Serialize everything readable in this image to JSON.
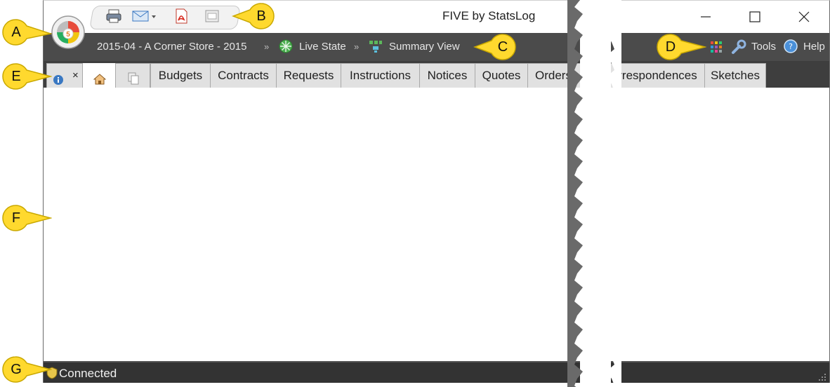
{
  "window": {
    "title": "FIVE by StatsLog",
    "controls": {
      "minimize": "minimize-icon",
      "maximize": "maximize-icon",
      "close": "close-icon"
    }
  },
  "quick_access": {
    "items": [
      "print-icon",
      "email-icon",
      "pdf-icon",
      "export-icon"
    ]
  },
  "breadcrumb": {
    "project": "2015-04 - A Corner Store - 2015",
    "separator": "»",
    "state": "Live State",
    "view": "Summary View"
  },
  "toolbar_right": {
    "tools_label": "Tools",
    "help_label": "Help"
  },
  "tabs": {
    "close_glyph": "×",
    "items": [
      "Budgets",
      "Contracts",
      "Requests",
      "Instructions",
      "Notices",
      "Quotes",
      "Orders"
    ],
    "right_items": [
      "rrespondences",
      "Sketches"
    ]
  },
  "status": {
    "text": "Connected"
  },
  "callouts": {
    "a": "A",
    "b": "B",
    "c": "C",
    "d": "D",
    "e": "E",
    "f": "F",
    "g": "G"
  },
  "colors": {
    "callout_fill": "#ffd92e",
    "callout_stroke": "#c9a800",
    "dark_bar": "#4b4b4b",
    "tab_bar": "#3e3e3e"
  }
}
